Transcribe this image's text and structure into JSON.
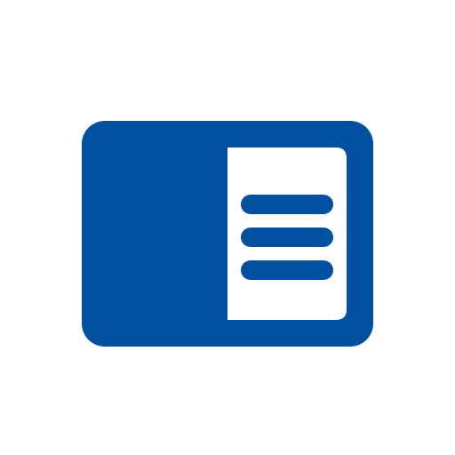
{
  "icon": {
    "name": "sidebar-panel-icon",
    "colors": {
      "frame": "#0250A0",
      "panel": "#FFFFFF",
      "line": "#0250A0",
      "background": "#FFFFFF"
    },
    "line_count": 3
  }
}
